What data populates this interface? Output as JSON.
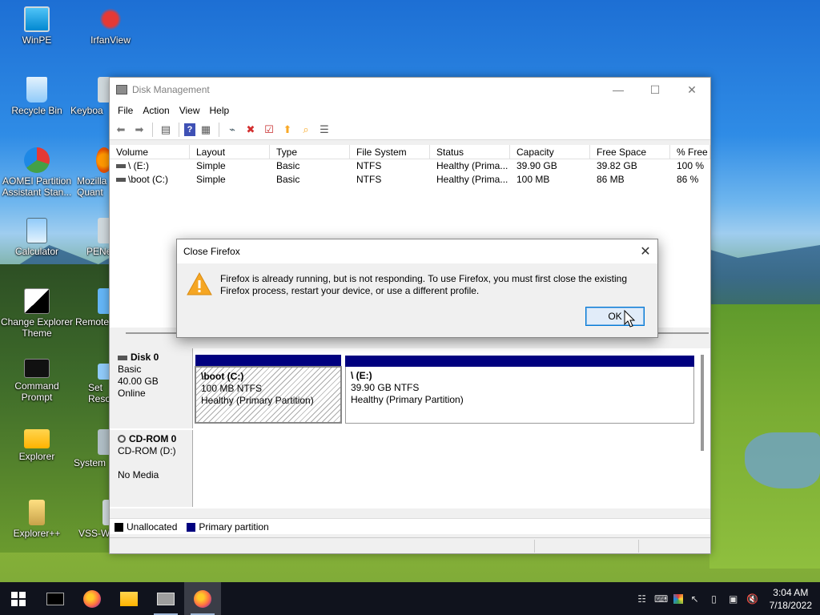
{
  "desktop": {
    "icons": [
      {
        "label": "WinPE"
      },
      {
        "label": "IrfanView"
      },
      {
        "label": "Recycle Bin"
      },
      {
        "label": "Keyboa"
      },
      {
        "label": "AOMEI Partition Assistant Stan..."
      },
      {
        "label": "Mozilla Quant"
      },
      {
        "label": "Calculator"
      },
      {
        "label": "PENe"
      },
      {
        "label": "Change Explorer Theme"
      },
      {
        "label": "Remote"
      },
      {
        "label": "Command Prompt"
      },
      {
        "label": "Set Reso"
      },
      {
        "label": "Explorer"
      },
      {
        "label": "System"
      },
      {
        "label": "Explorer++"
      },
      {
        "label": "VSS-W"
      }
    ]
  },
  "window": {
    "title": "Disk Management",
    "menu": [
      "File",
      "Action",
      "View",
      "Help"
    ],
    "volume_table": {
      "columns": [
        "Volume",
        "Layout",
        "Type",
        "File System",
        "Status",
        "Capacity",
        "Free Space",
        "% Free"
      ],
      "rows": [
        [
          "\\ (E:)",
          "Simple",
          "Basic",
          "NTFS",
          "Healthy (Prima...",
          "39.90 GB",
          "39.82 GB",
          "100 %"
        ],
        [
          "\\boot (C:)",
          "Simple",
          "Basic",
          "NTFS",
          "Healthy (Prima...",
          "100 MB",
          "86 MB",
          "86 %"
        ]
      ]
    },
    "disks": {
      "disk0": {
        "name": "Disk 0",
        "type": "Basic",
        "size": "40.00 GB",
        "state": "Online",
        "partitions": [
          {
            "name": "\\boot  (C:)",
            "size": "100 MB NTFS",
            "status": "Healthy (Primary Partition)"
          },
          {
            "name": "\\  (E:)",
            "size": "39.90 GB NTFS",
            "status": "Healthy (Primary Partition)"
          }
        ]
      },
      "cdrom0": {
        "name": "CD-ROM 0",
        "drive": "CD-ROM (D:)",
        "media": "No Media"
      }
    },
    "legend": [
      "Unallocated",
      "Primary partition"
    ],
    "colors": {
      "unallocated": "#000000",
      "primary": "#00007f"
    }
  },
  "dialog": {
    "title": "Close Firefox",
    "message": "Firefox is already running, but is not responding. To use Firefox, you must first close the existing Firefox process, restart your device, or use a different profile.",
    "ok_label": "OK"
  },
  "taskbar": {
    "time": "3:04 AM",
    "date": "7/18/2022"
  }
}
